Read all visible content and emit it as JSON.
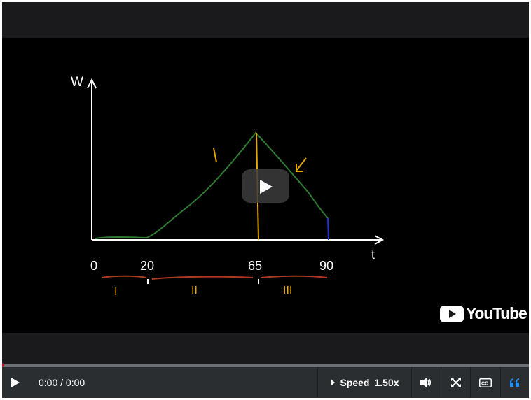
{
  "video": {
    "lesson_board": {
      "axis_y_label": "W",
      "axis_x_label": "t",
      "ticks": [
        "0",
        "20",
        "65",
        "90"
      ],
      "segments": [
        "I",
        "II",
        "III"
      ]
    },
    "center_button": "play-icon",
    "branding": "YouTube"
  },
  "player": {
    "progress_fraction": 0,
    "time_display": "0:00 / 0:00",
    "speed_label": "Speed",
    "speed_value": "1.50x",
    "icons": {
      "play": "play-icon",
      "speed": "caret-right-icon",
      "volume": "volume-icon",
      "fullscreen": "fullscreen-icon",
      "captions": "cc-icon",
      "transcript": "quote-icon"
    }
  },
  "colors": {
    "player_bg": "#2b2e31",
    "progress_played": "#d0021b",
    "transcript_accent": "#1e90ff",
    "curve_green": "#2e7d32",
    "marker_orange": "#e6a800",
    "brace_red": "#b03a1e"
  }
}
